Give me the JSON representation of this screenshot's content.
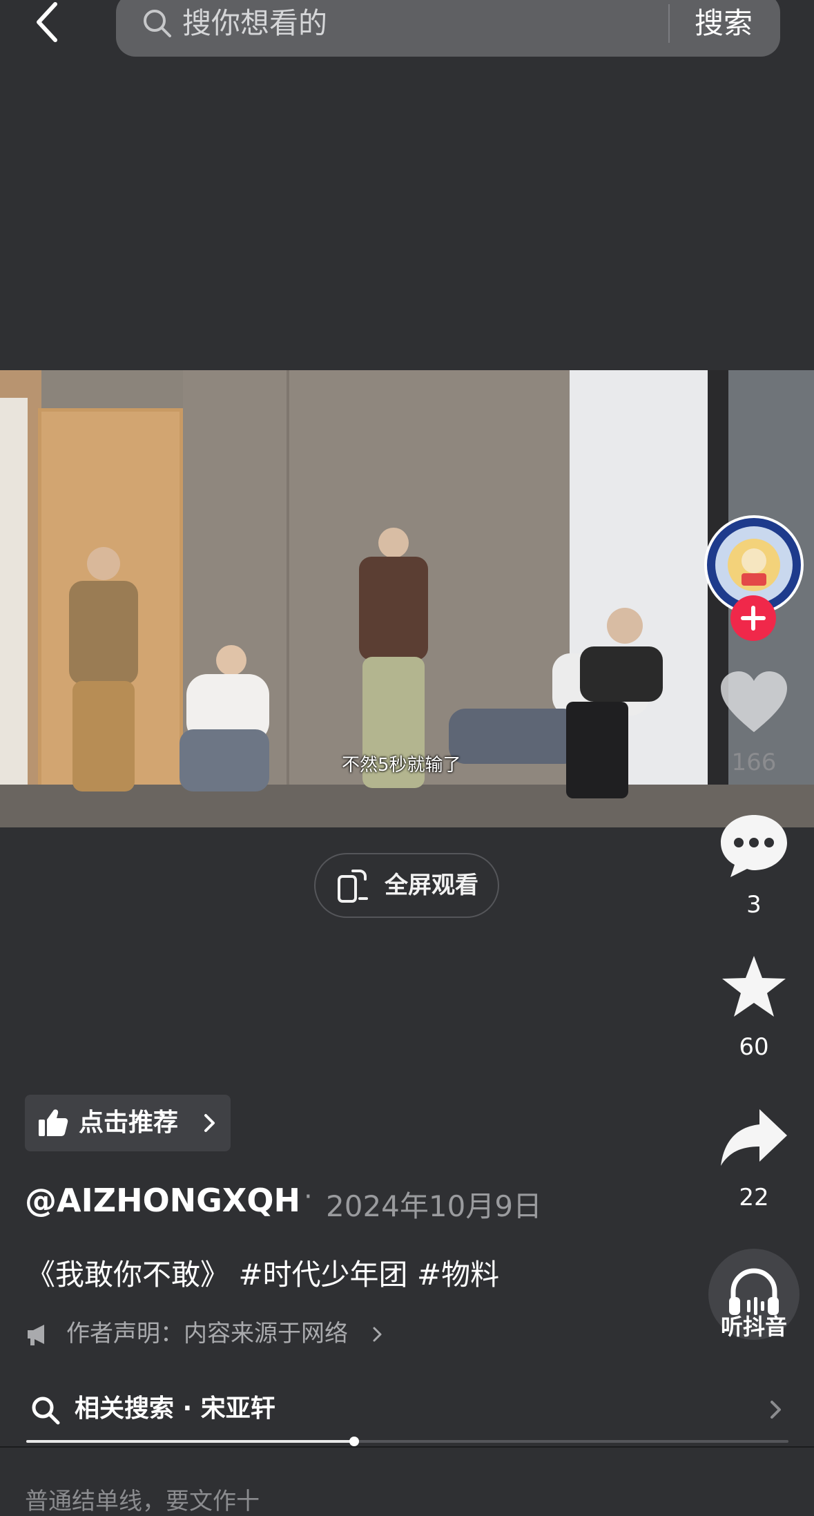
{
  "search": {
    "placeholder": "搜你想看的",
    "button_label": "搜索"
  },
  "video": {
    "subtitle": "不然5秒就输了"
  },
  "fullscreen": {
    "label": "全屏观看"
  },
  "rail": {
    "like_count": "166",
    "comment_count": "3",
    "favorite_count": "60",
    "share_count": "22",
    "listen_label": "听抖音"
  },
  "recommend": {
    "label": "点击推荐"
  },
  "post": {
    "author": "@AIZHONGXQH",
    "separator": "·",
    "date": "2024年10月9日",
    "caption": "《我敢你不敢》 #时代少年团 #物料",
    "declaration": "作者声明：内容来源于网络"
  },
  "related_search": {
    "label": "相关搜索 · 宋亚轩"
  },
  "playback": {
    "progress": 0.43
  },
  "bottom": {
    "text": "普通结单线，要文作十"
  },
  "colors": {
    "background": "#2f3033",
    "accent": "#f0284a"
  }
}
